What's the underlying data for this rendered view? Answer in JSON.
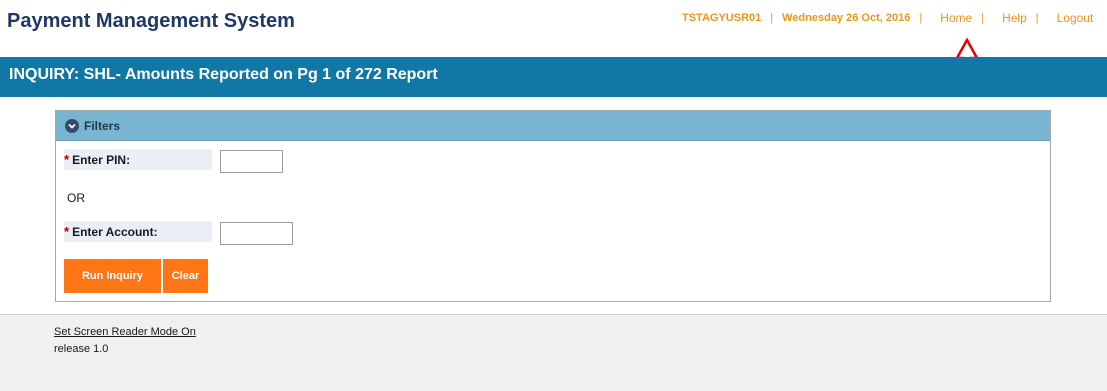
{
  "app": {
    "title": "Payment Management System"
  },
  "userbar": {
    "username": "TSTAGYUSR01",
    "date": "Wednesday 26 Oct, 2016",
    "separator": "|",
    "links": {
      "home": "Home",
      "help": "Help",
      "logout": "Logout"
    }
  },
  "icons": {
    "user": "user-icon",
    "toggle": "chevron-down-icon",
    "annotation": "up-arrow-icon"
  },
  "banner": {
    "title": "INQUIRY: SHL- Amounts Reported on Pg 1 of 272 Report"
  },
  "filters": {
    "title": "Filters",
    "pin": {
      "required_mark": "*",
      "label": "Enter PIN:",
      "value": ""
    },
    "or_text": "OR",
    "account": {
      "required_mark": "*",
      "label": "Enter Account:",
      "value": ""
    },
    "buttons": {
      "run": "Run Inquiry",
      "clear": "Clear"
    }
  },
  "footer": {
    "screen_reader_link": "Set Screen Reader Mode On",
    "release": "release 1.0"
  },
  "colors": {
    "banner": "#1177a5",
    "panel_header": "#79b5d1",
    "button": "#ff7617",
    "link_orange": "#e8961e",
    "title_navy": "#1f3864",
    "annotation_red": "#e0000a"
  }
}
